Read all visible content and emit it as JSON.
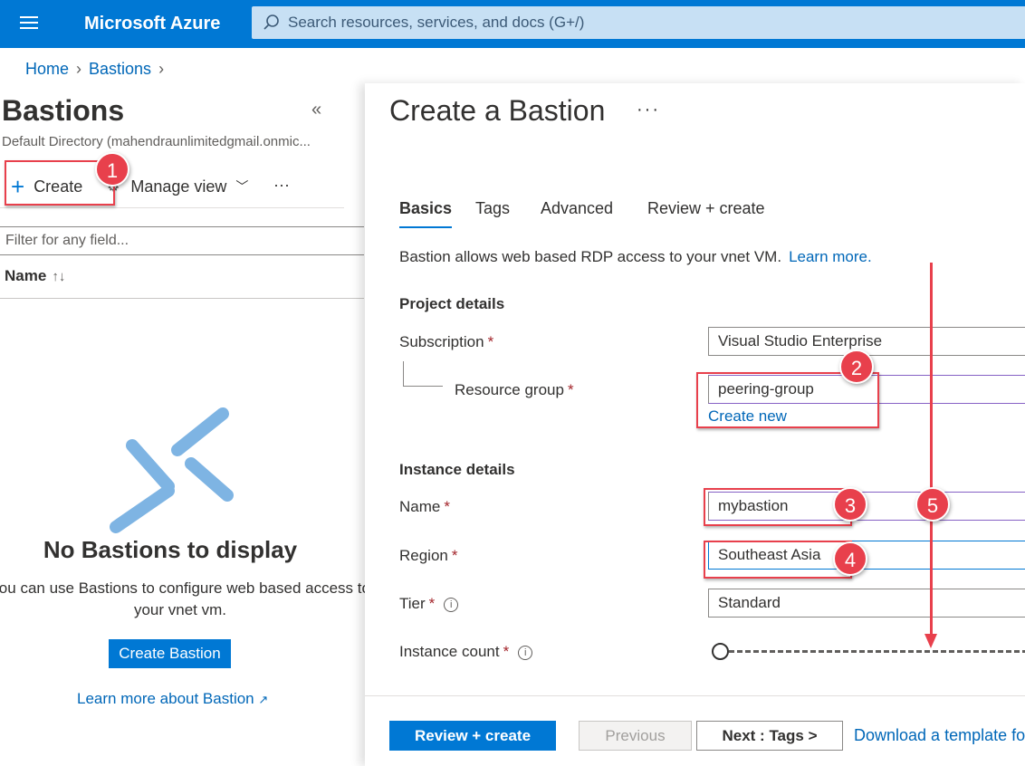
{
  "header": {
    "brand": "Microsoft Azure",
    "search_placeholder": "Search resources, services, and docs (G+/)"
  },
  "breadcrumb": {
    "home": "Home",
    "bastions": "Bastions"
  },
  "list_blade": {
    "title": "Bastions",
    "directory": "Default Directory (mahendraunlimitedgmail.onmic...",
    "toolbar": {
      "create": "Create",
      "manage_view": "Manage view",
      "more": "···"
    },
    "filter_placeholder": "Filter for any field...",
    "column_name": "Name",
    "sort_glyph": "↑↓",
    "empty_title": "No Bastions to display",
    "empty_desc": "You can use Bastions to configure web based access to your vnet vm.",
    "create_button": "Create Bastion",
    "learn_link": "Learn more about Bastion"
  },
  "create_blade": {
    "title": "Create a Bastion",
    "more": "···",
    "tabs": [
      "Basics",
      "Tags",
      "Advanced",
      "Review + create"
    ],
    "intro": "Bastion allows web based RDP access to your vnet VM.",
    "intro_link": "Learn more.",
    "project_section": "Project details",
    "subscription_label": "Subscription",
    "subscription_value": "Visual Studio Enterprise",
    "rg_label": "Resource group",
    "rg_value": "peering-group",
    "rg_create_new": "Create new",
    "instance_section": "Instance details",
    "name_label": "Name",
    "name_value": "mybastion",
    "region_label": "Region",
    "region_value": "Southeast Asia",
    "tier_label": "Tier",
    "tier_value": "Standard",
    "count_label": "Instance count",
    "required_mark": "*",
    "footer": {
      "review": "Review + create",
      "previous": "Previous",
      "next": "Next : Tags >",
      "download": "Download a template fo"
    }
  },
  "annotations": [
    "1",
    "2",
    "3",
    "4",
    "5"
  ],
  "colors": {
    "brand_blue": "#0078d4",
    "annotation_red": "#e8404c",
    "link": "#0067b8"
  }
}
